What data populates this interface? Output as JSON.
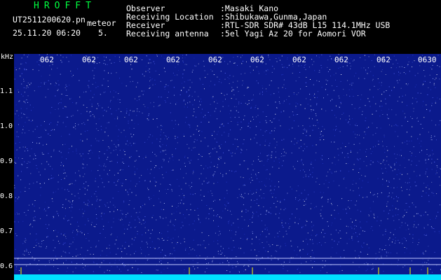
{
  "app_title": "HROFFT",
  "file_name": "UT2511200620.pn",
  "event_type": "meteor",
  "datetime": "25.11.20 06:20",
  "count": "5.",
  "info": [
    {
      "label": "Observer",
      "value": ":Masaki Kano"
    },
    {
      "label": "Receiving Location",
      "value": ":Shibukawa,Gunma,Japan"
    },
    {
      "label": "Receiver",
      "value": ":RTL-SDR SDR# 43dB L15 114.1MHz USB"
    },
    {
      "label": "Receiving antenna",
      "value": ":5el Yagi Az 20 for Aomori VOR"
    }
  ],
  "y_unit": "kHz",
  "y_ticks": [
    "1.1",
    "1.0",
    "0.9",
    "0.8",
    "0.7",
    "0.6"
  ],
  "x_ticks": [
    "062",
    "062",
    "062",
    "062",
    "062",
    "062",
    "062",
    "062",
    "062",
    "0630"
  ],
  "colors": {
    "background": "#0b1a8c",
    "noise": "#ffffff",
    "baseline": "#00e0ff",
    "marker": "#ffff00",
    "title": "#00ff40"
  }
}
